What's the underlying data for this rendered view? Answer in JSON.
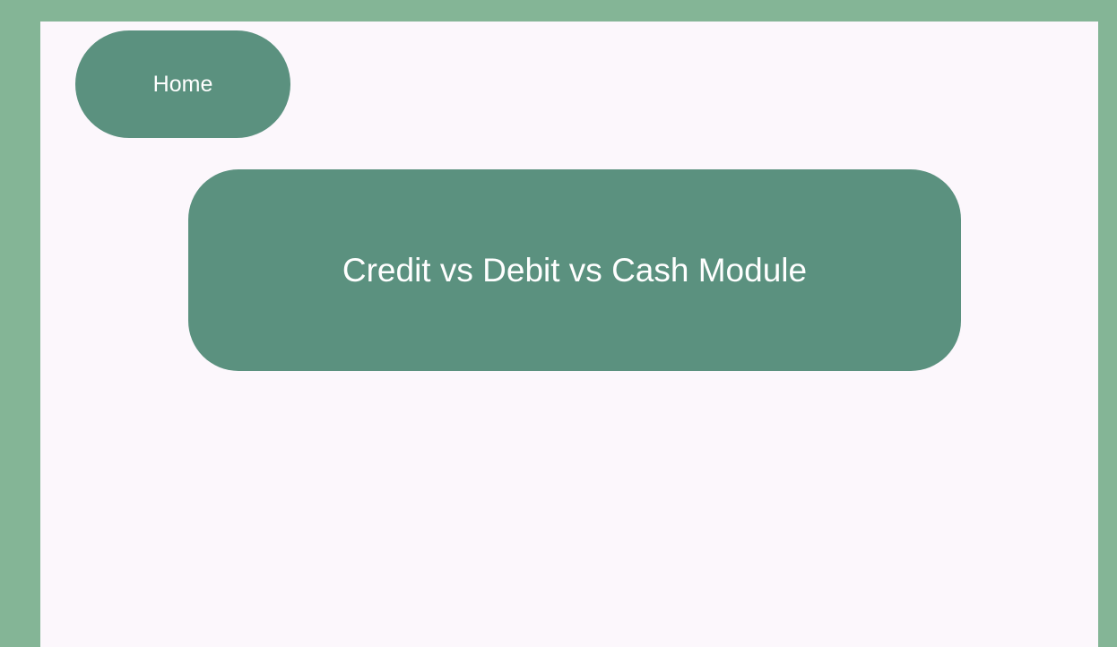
{
  "colors": {
    "outer_background": "#84B596",
    "panel_background": "#FCF7FC",
    "button_background": "#5B917F",
    "button_text": "#FFFFFF"
  },
  "nav": {
    "home_label": "Home"
  },
  "main": {
    "module_label": "Credit vs Debit vs Cash Module"
  }
}
